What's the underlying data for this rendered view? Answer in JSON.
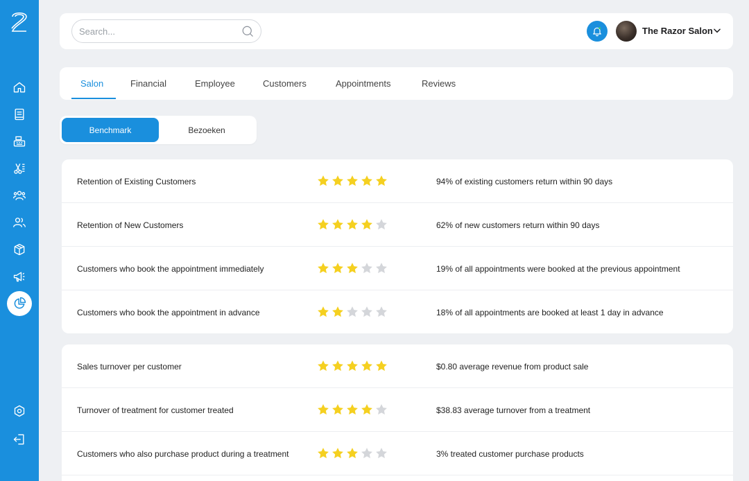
{
  "sidebar": {
    "items": [
      {
        "name": "home-icon"
      },
      {
        "name": "book-icon"
      },
      {
        "name": "cash-register-icon"
      },
      {
        "name": "scissors-icon"
      },
      {
        "name": "team-icon"
      },
      {
        "name": "customers-icon"
      },
      {
        "name": "box-icon"
      },
      {
        "name": "megaphone-icon"
      },
      {
        "name": "pie-chart-icon",
        "active": true
      },
      {
        "name": "settings-icon"
      },
      {
        "name": "logout-icon"
      }
    ]
  },
  "header": {
    "search_placeholder": "Search...",
    "user_name": "The Razor Salon"
  },
  "tabs": [
    {
      "label": "Salon",
      "active": true
    },
    {
      "label": "Financial"
    },
    {
      "label": "Employee"
    },
    {
      "label": "Customers"
    },
    {
      "label": "Appointments"
    },
    {
      "label": "Reviews"
    }
  ],
  "toggle": {
    "options": [
      {
        "label": "Benchmark",
        "active": true
      },
      {
        "label": "Bezoeken"
      }
    ]
  },
  "colors": {
    "accent": "#1a8fdd",
    "star_on": "#f5d020",
    "star_off": "#d4d6da"
  },
  "benchmark_groups": [
    {
      "rows": [
        {
          "label": "Retention of Existing Customers",
          "rating": 5,
          "description": "94% of existing customers return within 90 days"
        },
        {
          "label": "Retention of New Customers",
          "rating": 4,
          "description": "62% of new customers return within 90 days"
        },
        {
          "label": "Customers who book the appointment immediately",
          "rating": 3,
          "description": "19% of all appointments were booked at the previous appointment"
        },
        {
          "label": "Customers who book the appointment in advance",
          "rating": 2,
          "description": "18% of all appointments are booked at least 1 day in advance"
        }
      ]
    },
    {
      "rows": [
        {
          "label": "Sales turnover per customer",
          "rating": 5,
          "description": "$0.80 average revenue from product sale"
        },
        {
          "label": "Turnover of treatment for customer treated",
          "rating": 4,
          "description": "$38.83 average turnover from a treatment"
        },
        {
          "label": "Customers who also purchase product during a treatment",
          "rating": 3,
          "description": "3% treated customer purchase products"
        }
      ]
    }
  ]
}
